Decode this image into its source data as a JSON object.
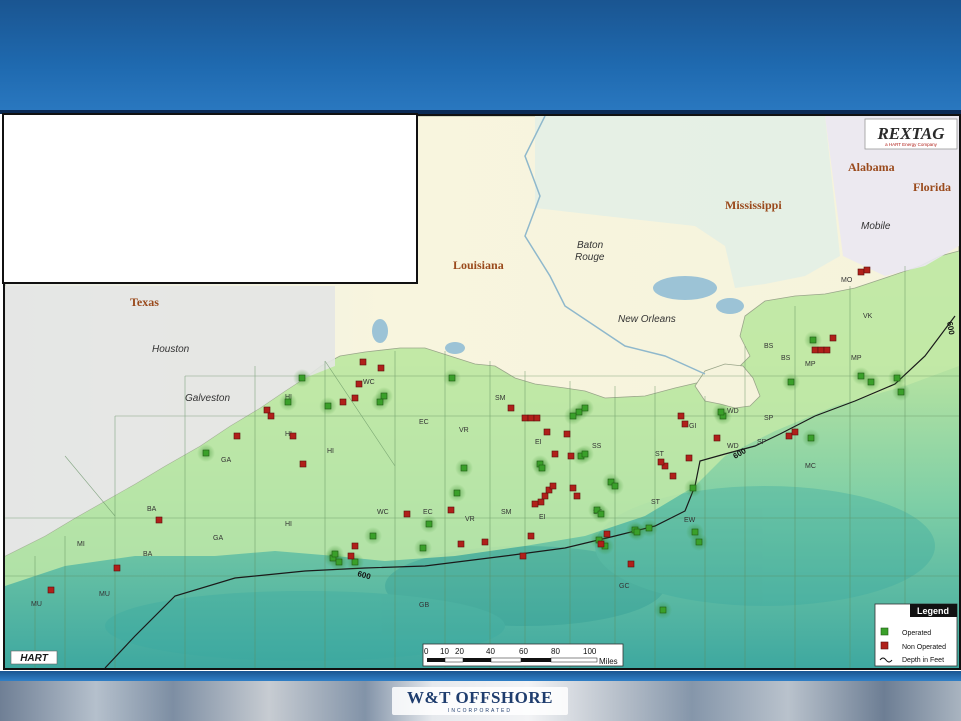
{
  "map": {
    "states": [
      "Texas",
      "Louisiana",
      "Mississippi",
      "Alabama",
      "Florida"
    ],
    "cities": [
      "Houston",
      "Galveston",
      "Baton Rouge",
      "New Orleans",
      "Mobile"
    ],
    "city_baton_1": "Baton",
    "city_baton_2": "Rouge",
    "area_labels": [
      "WC",
      "HI",
      "GA",
      "BA",
      "MI",
      "MU",
      "EC",
      "VR",
      "SM",
      "EI",
      "SS",
      "ST",
      "GI",
      "WD",
      "SP",
      "MP",
      "BS",
      "VK",
      "MO",
      "MC",
      "EW",
      "GC",
      "GB",
      "HI",
      "HI",
      "HI",
      "WC",
      "EC",
      "VR",
      "SM",
      "EI",
      "SS",
      "ST",
      "WD",
      "SP",
      "BS",
      "MP",
      "MU",
      "BA",
      "GA"
    ],
    "depth_labels": [
      "600",
      "600",
      "600"
    ]
  },
  "brand": {
    "rextag": "REXTAG",
    "rextag_sub": "a HART Energy Company",
    "hart": "HART",
    "footer_logo": "W&T OFFSHORE",
    "footer_logo_sub": "INCORPORATED"
  },
  "legend": {
    "title": "Legend",
    "items": [
      {
        "label": "Operated",
        "color": "#3aa02a"
      },
      {
        "label": "Non Operated",
        "color": "#b0201a"
      },
      {
        "label": "Depth in Feet",
        "color": "#111111"
      }
    ]
  },
  "scale": {
    "ticks": [
      "0",
      "10",
      "20",
      "40",
      "60",
      "80",
      "100"
    ],
    "unit": "Miles"
  },
  "colors": {
    "header": "#1f6ab0",
    "land": "#f7f5df",
    "shelf": "#c2e8a8",
    "deep": "#58b8a0",
    "operated": "#3aa02a",
    "non_operated": "#b0201a"
  }
}
